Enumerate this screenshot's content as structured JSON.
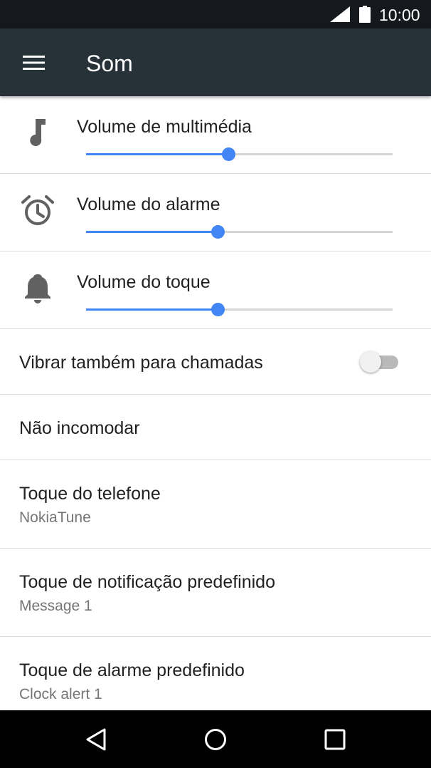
{
  "status_bar": {
    "time": "10:00"
  },
  "app_bar": {
    "title": "Som"
  },
  "volumes": [
    {
      "label": "Volume de multimédia",
      "icon": "music-note-icon",
      "level_percent": 46.5
    },
    {
      "label": "Volume do alarme",
      "icon": "alarm-clock-icon",
      "level_percent": 43
    },
    {
      "label": "Volume do toque",
      "icon": "bell-icon",
      "level_percent": 43
    }
  ],
  "vibrate": {
    "label": "Vibrar também para chamadas",
    "on": false
  },
  "dnd": {
    "label": "Não incomodar"
  },
  "phone_ringtone": {
    "label": "Toque do telefone",
    "value": "NokiaTune"
  },
  "notification_sound": {
    "label": "Toque de notificação predefinido",
    "value": "Message 1"
  },
  "alarm_sound": {
    "label": "Toque de alarme predefinido",
    "value": "Clock alert 1"
  },
  "colors": {
    "accent": "#4285f4",
    "app_bar": "#263238",
    "status_bar": "#15191d"
  }
}
